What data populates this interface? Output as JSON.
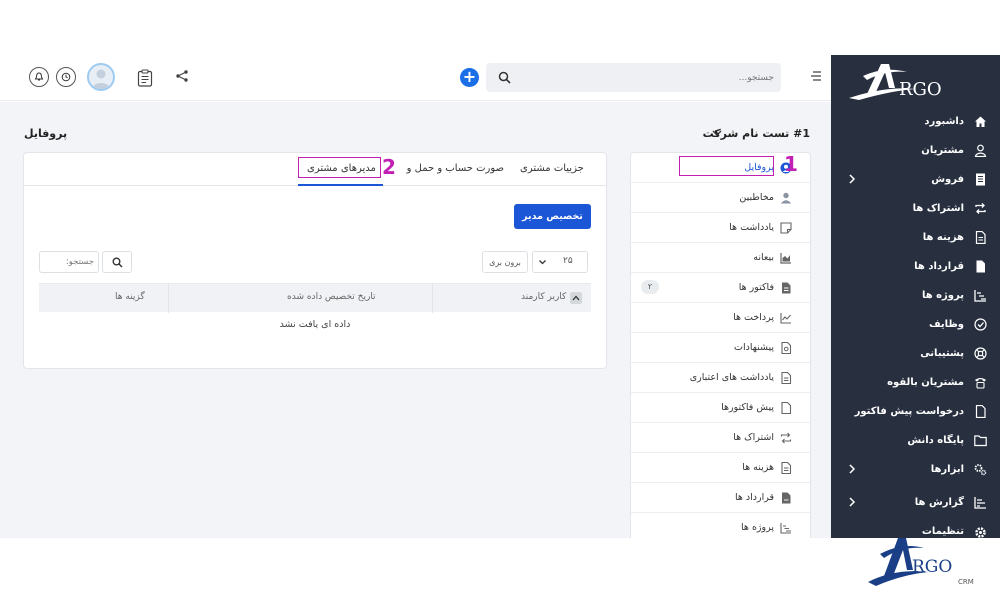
{
  "topbar": {
    "search_placeholder": "جستجو..."
  },
  "brand": {
    "name": "RGO",
    "sub": "CRM",
    "accent": "#1a56d6"
  },
  "sidebar": {
    "items": [
      {
        "label": "داشبورد",
        "icon": "home-icon",
        "chevron": false
      },
      {
        "label": "مشتریان",
        "icon": "user-icon",
        "chevron": false
      },
      {
        "label": "فروش",
        "icon": "receipt-icon",
        "chevron": true
      },
      {
        "label": "اشتراک ها",
        "icon": "repeat-icon",
        "chevron": false
      },
      {
        "label": "هزینه ها",
        "icon": "file-icon",
        "chevron": false
      },
      {
        "label": "قرارداد ها",
        "icon": "contract-icon",
        "chevron": false
      },
      {
        "label": "پروژه ها",
        "icon": "chart-icon",
        "chevron": false
      },
      {
        "label": "وظایف",
        "icon": "check-circle-icon",
        "chevron": false
      },
      {
        "label": "پشتیبانی",
        "icon": "lifebuoy-icon",
        "chevron": false
      },
      {
        "label": "مشتریان بالقوه",
        "icon": "phone-icon",
        "chevron": false
      },
      {
        "label": "درخواست پیش فاکتور",
        "icon": "document-icon",
        "chevron": false
      },
      {
        "label": "پایگاه دانش",
        "icon": "folder-icon",
        "chevron": false
      },
      {
        "label": "ابزارها",
        "icon": "cogs-icon",
        "chevron": true
      },
      {
        "label": "گزارش ها",
        "icon": "bar-chart-icon",
        "chevron": true
      },
      {
        "label": "تنظیمات",
        "icon": "gear-icon",
        "chevron": false
      }
    ]
  },
  "page": {
    "company_title": "#1 تست نام شرکت",
    "section_title": "پروفایل"
  },
  "client_menu": {
    "items": [
      {
        "label": "پروفایل",
        "icon": "profile-icon",
        "active": true
      },
      {
        "label": "مخاطبین",
        "icon": "contact-icon",
        "active": false
      },
      {
        "label": "یادداشت ها",
        "icon": "note-icon",
        "active": false
      },
      {
        "label": "بیعانه",
        "icon": "deposit-icon",
        "active": false
      },
      {
        "label": "فاکتور ها",
        "icon": "invoice-icon",
        "active": false,
        "badge": "۲"
      },
      {
        "label": "پرداخت ها",
        "icon": "payment-icon",
        "active": false
      },
      {
        "label": "پیشنهادات",
        "icon": "proposal-icon",
        "active": false
      },
      {
        "label": "یادداشت های اعتباری",
        "icon": "credit-note-icon",
        "active": false
      },
      {
        "label": "پیش فاکتورها",
        "icon": "estimate-icon",
        "active": false
      },
      {
        "label": "اشتراک ها",
        "icon": "subscription-icon",
        "active": false
      },
      {
        "label": "هزینه ها",
        "icon": "expense-icon",
        "active": false
      },
      {
        "label": "قرارداد ها",
        "icon": "contract-doc-icon",
        "active": false
      },
      {
        "label": "پروژه ها",
        "icon": "project-icon",
        "active": false
      }
    ]
  },
  "tabs": {
    "details": "جزییات مشتری",
    "statement": "صورت حساب و حمل و نقل",
    "managers": "مدیرهای مشتری"
  },
  "managers": {
    "assign_button": "تخصیص مدیر",
    "page_length": "۲۵",
    "export_button": "برون بری",
    "filter_placeholder": "جستجو:",
    "columns": [
      "کاربر کارمند",
      "تاریخ تخصیص داده شده",
      "گزینه ها"
    ],
    "empty_message": "داده ای یافت نشد"
  },
  "annotations": {
    "one": "1",
    "two": "2",
    "color": "#c21fb5"
  }
}
